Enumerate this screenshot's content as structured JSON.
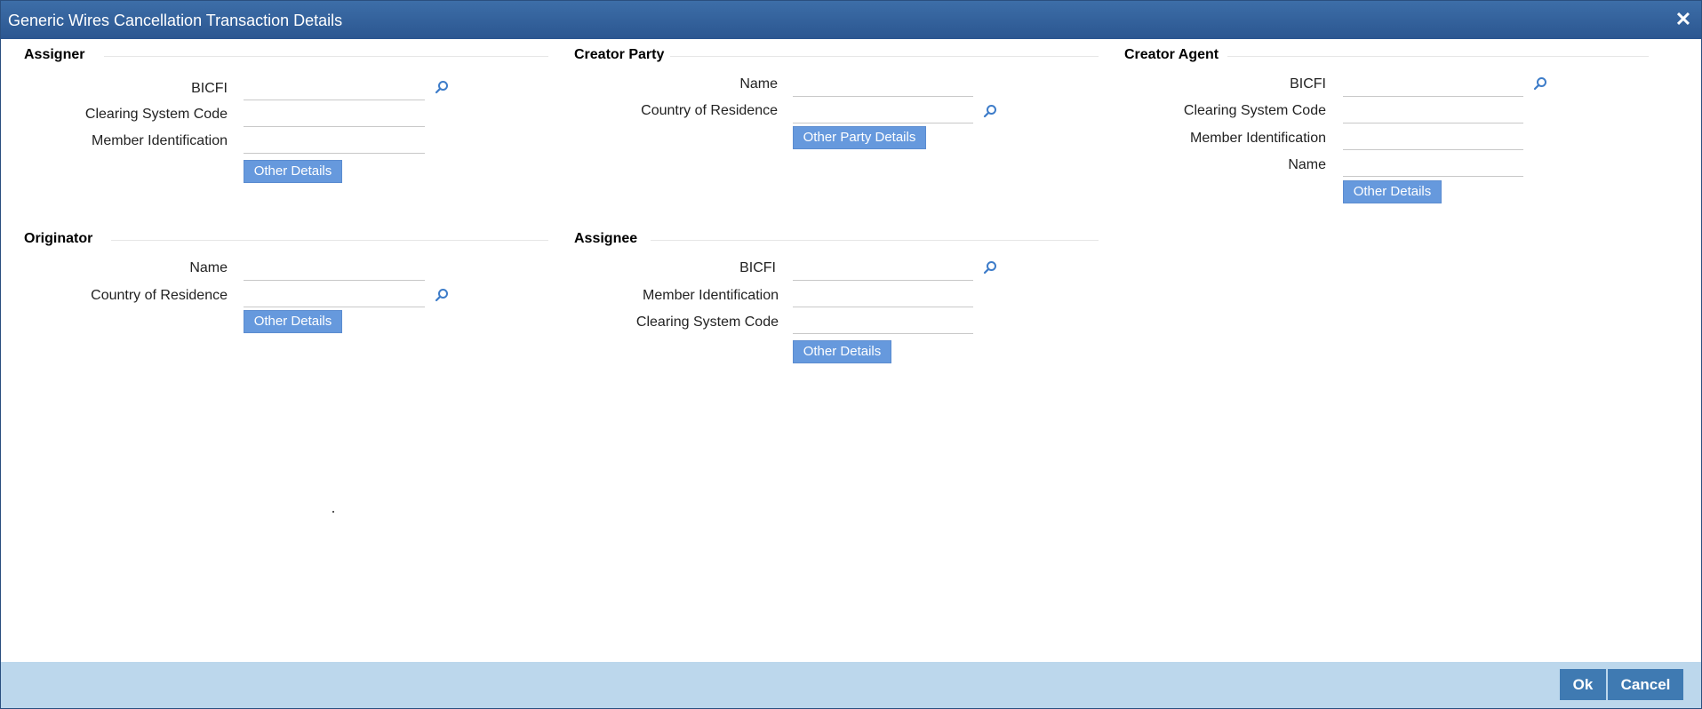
{
  "window": {
    "title": "Generic Wires Cancellation Transaction Details",
    "close_glyph": "✕"
  },
  "colors": {
    "titlebar": "#2b5690",
    "button": "#6699dd",
    "footer": "#bcd7ec",
    "footer_button": "#3f7ab2"
  },
  "assigner": {
    "header": "Assigner",
    "bicfi_label": "BICFI",
    "bicfi_value": "",
    "clearing_label": "Clearing System Code",
    "clearing_value": "",
    "member_label": "Member Identification",
    "member_value": "",
    "other_details": "Other Details",
    "lookup_icon": "search-icon"
  },
  "creator_party": {
    "header": "Creator Party",
    "name_label": "Name",
    "name_value": "",
    "country_label": "Country of Residence",
    "country_value": "",
    "other_party_details": "Other Party Details",
    "lookup_icon": "search-icon"
  },
  "creator_agent": {
    "header": "Creator Agent",
    "bicfi_label": "BICFI",
    "bicfi_value": "",
    "clearing_label": "Clearing System Code",
    "clearing_value": "",
    "member_label": "Member Identification",
    "member_value": "",
    "name_label": "Name",
    "name_value": "",
    "other_details": "Other Details",
    "lookup_icon": "search-icon"
  },
  "originator": {
    "header": "Originator",
    "name_label": "Name",
    "name_value": "",
    "country_label": "Country of Residence",
    "country_value": "",
    "other_details": "Other Details",
    "lookup_icon": "search-icon"
  },
  "assignee": {
    "header": "Assignee",
    "bicfi_label": "BICFI",
    "bicfi_value": "",
    "member_label": "Member Identification",
    "member_value": "",
    "clearing_label": "Clearing System Code",
    "clearing_value": "",
    "other_details": "Other Details",
    "lookup_icon": "search-icon"
  },
  "footer": {
    "ok_label": "Ok",
    "cancel_label": "Cancel"
  }
}
